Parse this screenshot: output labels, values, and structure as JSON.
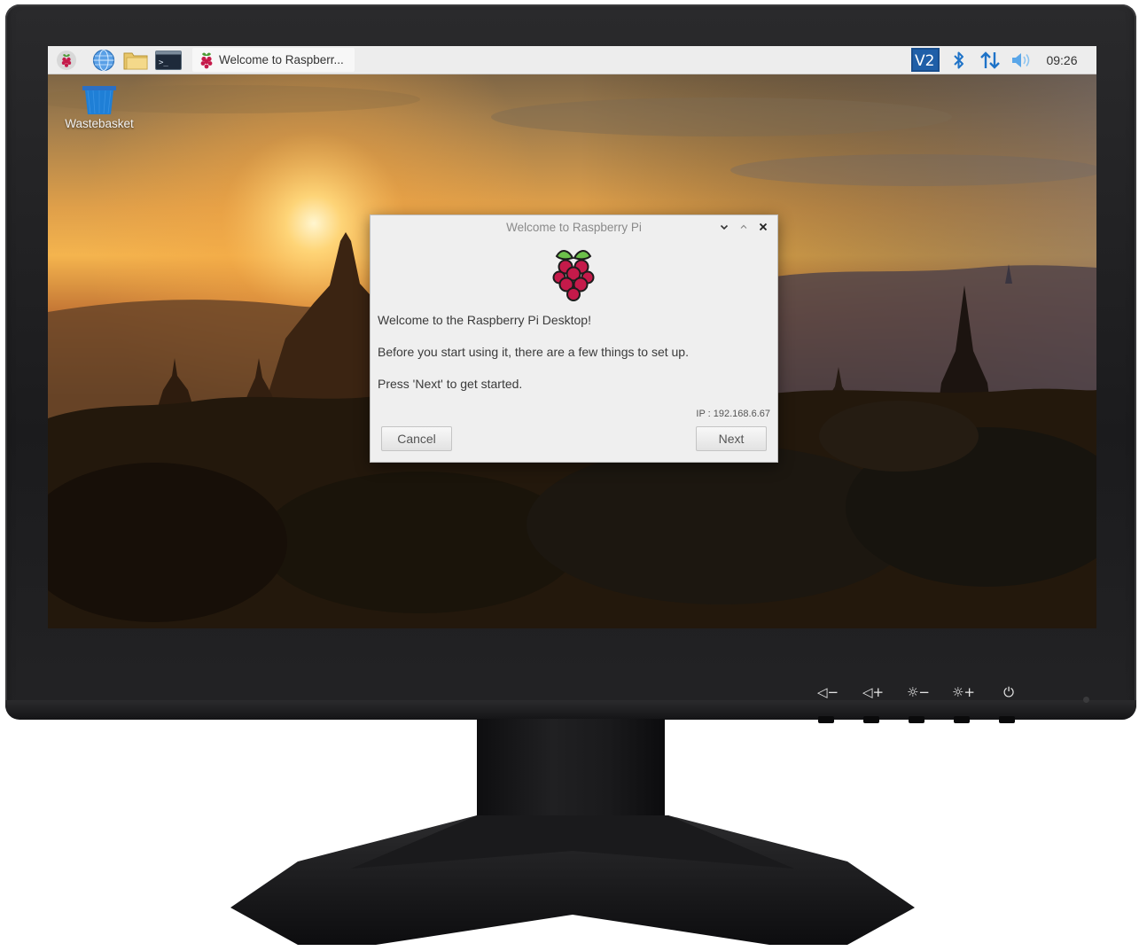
{
  "taskbar": {
    "launchers": [
      {
        "icon": "raspberry-menu-icon"
      },
      {
        "icon": "web-browser-icon"
      },
      {
        "icon": "file-manager-icon"
      },
      {
        "icon": "terminal-icon"
      }
    ],
    "active_task": {
      "icon": "raspberry-icon",
      "label": "Welcome to Raspberr..."
    },
    "tray": {
      "vnc_icon": "vnc-icon",
      "bluetooth_icon": "bluetooth-icon",
      "network_icon": "network-updown-icon",
      "volume_icon": "volume-icon",
      "clock": "09:26"
    }
  },
  "desktop": {
    "icons": [
      {
        "icon": "wastebasket-icon",
        "label": "Wastebasket"
      }
    ]
  },
  "dialog": {
    "title": "Welcome to Raspberry Pi",
    "welcome": "Welcome to the Raspberry Pi Desktop!",
    "setup_line": "Before you start using it, there are a few things to set up.",
    "prompt_line": "Press 'Next' to get started.",
    "ip": "IP : 192.168.6.67",
    "cancel_label": "Cancel",
    "next_label": "Next"
  },
  "monitor": {
    "controls": [
      "◁−",
      "◁+",
      "☼−",
      "☼+",
      "⏻"
    ]
  },
  "colors": {
    "accent_blue": "#1e73c8",
    "raspberry_red": "#c51a4a",
    "leaf_green": "#6cc04a",
    "taskbar_bg": "#ededed",
    "dialog_bg": "#efefef"
  }
}
